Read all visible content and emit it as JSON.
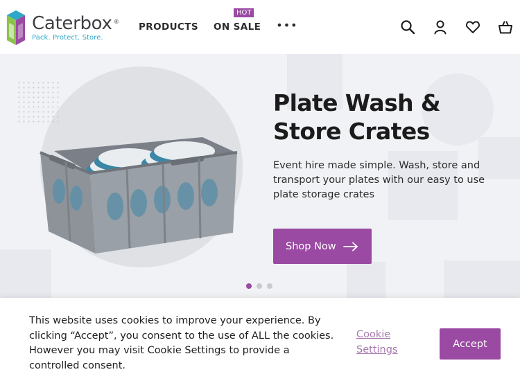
{
  "header": {
    "logo": {
      "name": "Caterbox",
      "registered": "®",
      "tagline": "Pack. Protect. Store."
    },
    "nav": [
      {
        "label": "PRODUCTS"
      },
      {
        "label": "ON SALE",
        "badge": "HOT"
      }
    ],
    "more_icon": "more-dots-icon",
    "icons": [
      "search-icon",
      "account-icon",
      "wishlist-heart-icon",
      "basket-icon"
    ]
  },
  "hero": {
    "title": "Plate Wash & Store Crates",
    "description": "Event hire made simple. Wash, store and transport your plates with our easy to use plate storage crates",
    "cta_label": "Shop Now",
    "slides_total": 3,
    "active_slide": 1
  },
  "cookie": {
    "text": "This website uses cookies to improve your experience. By clicking “Accept”, you consent to the use of ALL the cookies. However you may visit Cookie Settings to provide a controlled consent.",
    "settings_label": "Cookie Settings",
    "accept_label": "Accept"
  },
  "colors": {
    "brand_purple": "#9a4aa2",
    "hero_background": "#f1f2f5",
    "link_purple": "#a878b0",
    "tagline_blue": "#2fa7c9"
  }
}
